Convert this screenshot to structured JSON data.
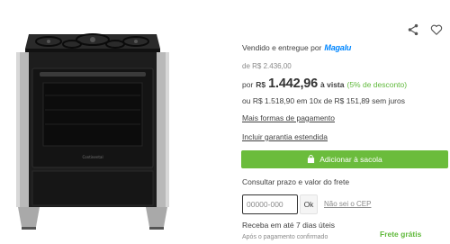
{
  "product": {
    "image_label": "Continental",
    "image_alt": "Fogão Continental preto com tampa de vidro"
  },
  "actions": {
    "share_icon": "share-icon",
    "favorite_icon": "heart-icon"
  },
  "seller": {
    "prefix": "Vendido e entregue por",
    "brand": "Magalu",
    "brand_color": "#0086ff"
  },
  "pricing": {
    "old_price": "de R$ 2.436,00",
    "por": "por",
    "currency": "R$",
    "main_price": "1.442,96",
    "cash_label": "à vista",
    "discount": "(5% de desconto)",
    "installments": "ou R$ 1.518,90 em 10x de R$ 151,89 sem juros",
    "discount_color": "#5fb93a"
  },
  "links": {
    "payment_methods": "Mais formas de pagamento",
    "warranty": "Incluir garantia estendida"
  },
  "cart": {
    "add_label": "Adicionar à sacola",
    "button_color": "#6bbc3c"
  },
  "freight": {
    "title": "Consultar prazo e valor do frete",
    "cep_placeholder": "00000-000",
    "ok_label": "Ok",
    "help_link": "Não sei o CEP",
    "delivery_time": "Receba em até 7 dias úteis",
    "delivery_note": "Após o pagamento confirmado",
    "free_shipping": "Frete grátis"
  }
}
